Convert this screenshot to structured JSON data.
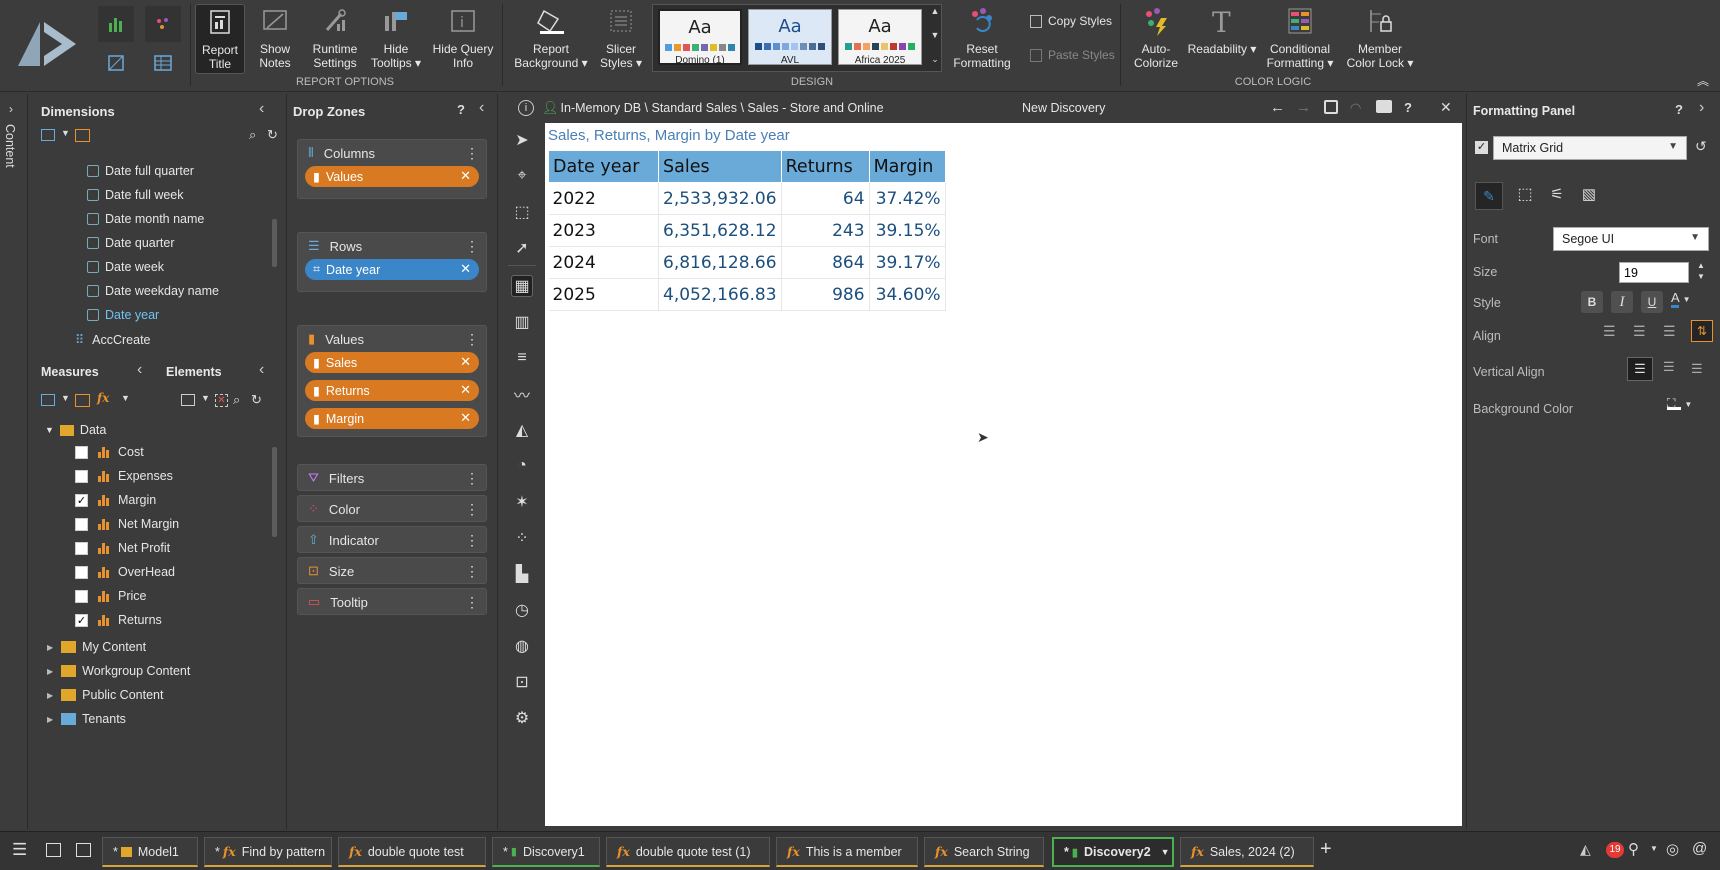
{
  "ribbon": {
    "report_options": {
      "label": "REPORT OPTIONS",
      "buttons": [
        "Report\nTitle",
        "Show\nNotes",
        "Runtime\nSettings",
        "Hide\nTooltips ▾",
        "Hide Query\nInfo"
      ]
    },
    "design": {
      "label": "DESIGN",
      "buttons": [
        "Report\nBackground ▾",
        "Slicer\nStyles ▾"
      ],
      "themes": [
        {
          "name": "Domino (1)",
          "aa": "Aa",
          "swatches": [
            "#4d9de0",
            "#e89a2c",
            "#e15554",
            "#3bb273",
            "#7768ae",
            "#e1bc29",
            "#888888",
            "#2e86ab"
          ]
        },
        {
          "name": "AVL",
          "aa": "Aa",
          "swatches": [
            "#1f4e8c",
            "#3a6fb0",
            "#5b8fd0",
            "#7fa8e0",
            "#a5c3ee",
            "#6d8fb5",
            "#4a6d95",
            "#2d4f7a"
          ]
        },
        {
          "name": "Africa 2025",
          "aa": "Aa",
          "swatches": [
            "#2a9d8f",
            "#e76f51",
            "#f4a261",
            "#264653",
            "#e9c46a",
            "#c0392b",
            "#8e44ad",
            "#27ae60"
          ]
        }
      ],
      "reset": "Reset\nFormatting",
      "copy_styles": "Copy Styles",
      "paste_styles": "Paste Styles"
    },
    "color_logic": {
      "label": "COLOR LOGIC",
      "buttons": [
        "Auto-\nColorize",
        "Readability ▾",
        "Conditional\nFormatting ▾",
        "Member\nColor Lock ▾"
      ]
    }
  },
  "left_strip": {
    "label": "Content"
  },
  "dimensions": {
    "title": "Dimensions",
    "items": [
      {
        "label": "Date full quarter",
        "selected": false
      },
      {
        "label": "Date full week",
        "selected": false
      },
      {
        "label": "Date month name",
        "selected": false
      },
      {
        "label": "Date quarter",
        "selected": false
      },
      {
        "label": "Date week",
        "selected": false
      },
      {
        "label": "Date weekday name",
        "selected": false
      },
      {
        "label": "Date year",
        "selected": true
      }
    ],
    "hierarchy": "AccCreate"
  },
  "measures": {
    "tab1": "Measures",
    "tab2": "Elements",
    "folder": "Data",
    "items": [
      {
        "label": "Cost",
        "checked": false
      },
      {
        "label": "Expenses",
        "checked": false
      },
      {
        "label": "Margin",
        "checked": true
      },
      {
        "label": "Net Margin",
        "checked": false
      },
      {
        "label": "Net Profit",
        "checked": false
      },
      {
        "label": "OverHead",
        "checked": false
      },
      {
        "label": "Price",
        "checked": false
      },
      {
        "label": "Returns",
        "checked": true
      }
    ]
  },
  "content_tree": [
    "My Content",
    "Workgroup Content",
    "Public Content",
    "Tenants"
  ],
  "drop_zones": {
    "title": "Drop Zones",
    "columns": {
      "label": "Columns",
      "pills": [
        "Values"
      ]
    },
    "rows": {
      "label": "Rows",
      "pills": [
        "Date year"
      ]
    },
    "values": {
      "label": "Values",
      "pills": [
        "Sales",
        "Returns",
        "Margin"
      ]
    },
    "others": [
      "Filters",
      "Color",
      "Indicator",
      "Size",
      "Tooltip"
    ]
  },
  "canvas": {
    "breadcrumb": "In-Memory DB \\ Standard Sales \\ Sales - Store and Online",
    "title": "New Discovery"
  },
  "grid": {
    "title": "Sales, Returns, Margin by Date year",
    "headers": [
      "Date year",
      "Sales",
      "Returns",
      "Margin"
    ],
    "rows": [
      [
        "2022",
        "2,533,932.06",
        "64",
        "37.42%"
      ],
      [
        "2023",
        "6,351,628.12",
        "243",
        "39.15%"
      ],
      [
        "2024",
        "6,816,128.66",
        "864",
        "39.17%"
      ],
      [
        "2025",
        "4,052,166.83",
        "986",
        "34.60%"
      ]
    ]
  },
  "formatting": {
    "title": "Formatting Panel",
    "target": "Matrix Grid",
    "font_label": "Font",
    "font_value": "Segoe UI",
    "size_label": "Size",
    "size_value": "19",
    "style_label": "Style",
    "align_label": "Align",
    "valign_label": "Vertical Align",
    "bg_label": "Background Color",
    "style_buttons": [
      "B",
      "I",
      "U"
    ]
  },
  "taskbar": {
    "tabs": [
      {
        "label": "Model1",
        "type": "model",
        "modified": true
      },
      {
        "label": "Find by pattern",
        "type": "fx",
        "modified": true
      },
      {
        "label": "double quote test",
        "type": "fx",
        "modified": false
      },
      {
        "label": "Discovery1",
        "type": "discovery",
        "modified": true
      },
      {
        "label": "double quote test (1)",
        "type": "fx",
        "modified": false
      },
      {
        "label": "This is a member",
        "type": "fx",
        "modified": false
      },
      {
        "label": "Search String",
        "type": "fx",
        "modified": false
      },
      {
        "label": "Discovery2",
        "type": "discovery",
        "modified": true,
        "active": true
      },
      {
        "label": "Sales, 2024 (2)",
        "type": "fx",
        "modified": false
      }
    ],
    "notifications": "19"
  }
}
